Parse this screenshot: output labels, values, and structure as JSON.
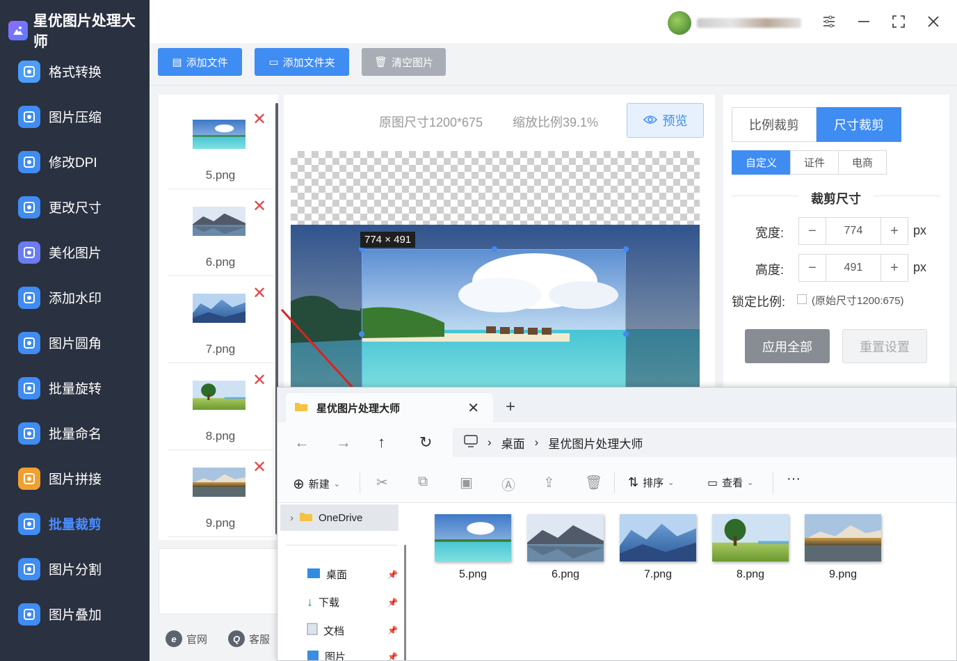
{
  "app": {
    "title": "星优图片处理大师"
  },
  "sidebar": {
    "items": [
      {
        "label": "格式转换",
        "icon": "image-convert-icon",
        "color": "#4a9df8"
      },
      {
        "label": "图片压缩",
        "icon": "compress-icon",
        "color": "#3f8cf3"
      },
      {
        "label": "修改DPI",
        "icon": "dpi-icon",
        "color": "#3f8cf3"
      },
      {
        "label": "更改尺寸",
        "icon": "resize-icon",
        "color": "#3f8cf3"
      },
      {
        "label": "美化图片",
        "icon": "beautify-icon",
        "color": "#6a7cf0"
      },
      {
        "label": "添加水印",
        "icon": "watermark-icon",
        "color": "#3f8cf3"
      },
      {
        "label": "图片圆角",
        "icon": "round-corner-icon",
        "color": "#3f8cf3"
      },
      {
        "label": "批量旋转",
        "icon": "rotate-icon",
        "color": "#3f8cf3"
      },
      {
        "label": "批量命名",
        "icon": "rename-icon",
        "color": "#3f8cf3"
      },
      {
        "label": "图片拼接",
        "icon": "puzzle-icon",
        "color": "#f0a030"
      },
      {
        "label": "批量裁剪",
        "icon": "crop-icon",
        "color": "#3f8cf3"
      },
      {
        "label": "图片分割",
        "icon": "split-icon",
        "color": "#3f8cf3"
      },
      {
        "label": "图片叠加",
        "icon": "layers-icon",
        "color": "#3f8cf3"
      }
    ],
    "active_index": 10
  },
  "toolbar": {
    "add_file": "添加文件",
    "add_folder": "添加文件夹",
    "clear": "清空图片"
  },
  "files": [
    "5.png",
    "6.png",
    "7.png",
    "8.png",
    "9.png"
  ],
  "footer": {
    "website": "官网",
    "service": "客服"
  },
  "preview": {
    "original_size": "原图尺寸1200*675",
    "scale": "缩放比例39.1%",
    "preview_button": "预览",
    "crop_tag": "774 × 491"
  },
  "crop_panel": {
    "mode_ratio": "比例裁剪",
    "mode_size": "尺寸裁剪",
    "sub_custom": "自定义",
    "sub_id": "证件",
    "sub_ecommerce": "电商",
    "section_title": "裁剪尺寸",
    "width_label": "宽度:",
    "width_value": "774",
    "height_label": "高度:",
    "height_value": "491",
    "unit": "px",
    "lock_label": "锁定比例:",
    "lock_note": "(原始尺寸1200:675)",
    "apply_all": "应用全部",
    "reset": "重置设置"
  },
  "explorer": {
    "tab_title": "星优图片处理大师",
    "breadcrumb": [
      "桌面",
      "星优图片处理大师"
    ],
    "commands": {
      "new": "新建",
      "sort": "排序",
      "view": "查看"
    },
    "sidebar": {
      "onedrive": "OneDrive",
      "quick": [
        "桌面",
        "下载",
        "文档",
        "图片"
      ]
    },
    "files": [
      "5.png",
      "6.png",
      "7.png",
      "8.png",
      "9.png"
    ]
  },
  "colors": {
    "accent": "#3f8cf3",
    "sidebar_bg": "#2a3140",
    "delete": "#e14848"
  }
}
